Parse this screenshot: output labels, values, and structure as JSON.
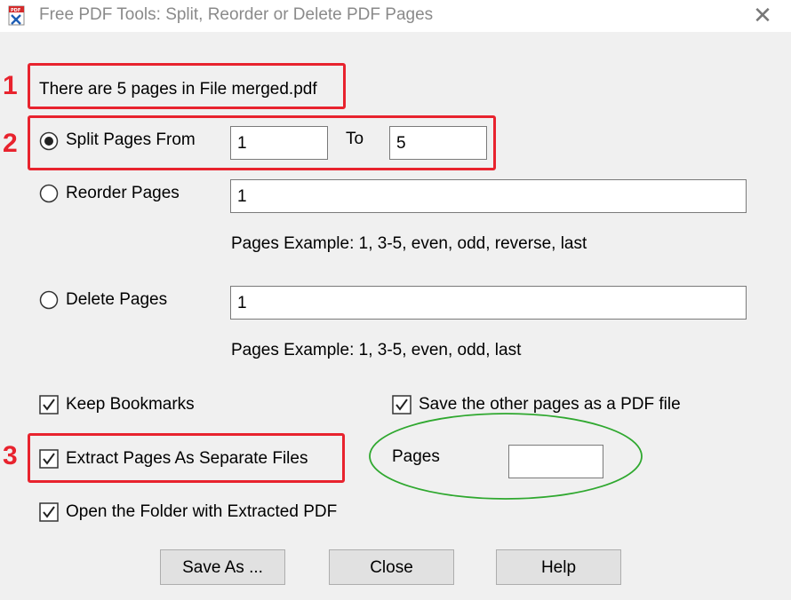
{
  "window": {
    "title": "Free PDF Tools: Split, Reorder or Delete PDF Pages",
    "close_symbol": "✕"
  },
  "info": {
    "text": "There are 5 pages in File merged.pdf"
  },
  "split": {
    "label": "Split Pages From",
    "selected": true,
    "from_value": "1",
    "to_label": "To",
    "to_value": "5"
  },
  "reorder": {
    "label": "Reorder Pages",
    "selected": false,
    "value": "1",
    "example": "Pages Example: 1, 3-5, even, odd, reverse, last"
  },
  "delete": {
    "label": "Delete Pages",
    "selected": false,
    "value": "1",
    "example": "Pages Example: 1, 3-5, even, odd, last"
  },
  "options": {
    "keep_bookmarks": {
      "label": "Keep Bookmarks",
      "checked": true
    },
    "save_other": {
      "label": "Save the other pages as a PDF file",
      "checked": true
    },
    "extract_separate": {
      "label": "Extract Pages As Separate Files",
      "checked": true
    },
    "open_folder": {
      "label": "Open the Folder with Extracted PDF",
      "checked": true
    },
    "pages_label": "Pages",
    "pages_value": ""
  },
  "buttons": {
    "save_as": "Save As ...",
    "close": "Close",
    "help": "Help"
  },
  "annotations": {
    "marker_1": "1",
    "marker_2": "2",
    "marker_3": "3",
    "highlight_color": "#e8232e",
    "ellipse_color": "#2fa82f"
  }
}
